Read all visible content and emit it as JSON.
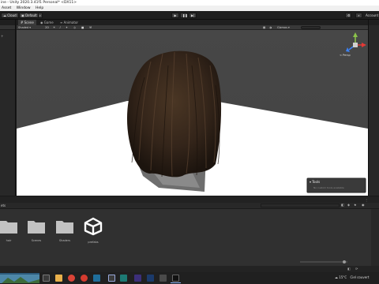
{
  "window": {
    "title": "ine - Unity 2020.3.41f1 Personal* <DX11>"
  },
  "menu": {
    "items": [
      "Asset",
      "Window",
      "Help"
    ]
  },
  "toolbar": {
    "cloud_label": "Cloud",
    "default_label": "Default",
    "play_icon": "play-icon",
    "pause_icon": "pause-icon",
    "step_icon": "step-icon",
    "account_label": "Account"
  },
  "tabs": {
    "scene": "Scene",
    "game": "Game",
    "animator": "Animator"
  },
  "scene_toolbar": {
    "shading_mode": "Shaded",
    "dim_2d": "2D",
    "gizmos": "Gizmos"
  },
  "scene": {
    "persp_label": "< Persp",
    "tools_panel_title": "Tools",
    "tools_panel_text": "No custom tools available"
  },
  "project": {
    "tab_label": "ets",
    "items": [
      {
        "label": "hair",
        "icon": "folder-icon"
      },
      {
        "label": "Scenes",
        "icon": "folder-icon"
      },
      {
        "label": "Shaders",
        "icon": "folder-icon"
      },
      {
        "label": "prefabs",
        "icon": "unity-logo-icon"
      }
    ]
  },
  "taskbar": {
    "weather": "15°C",
    "weather_text": "Ciel couvert"
  },
  "colors": {
    "editor_bg": "#191919",
    "panel": "#282828",
    "viewport_bg": "#454545",
    "ground": "#ffffff",
    "hair": "#3a2a1c"
  }
}
